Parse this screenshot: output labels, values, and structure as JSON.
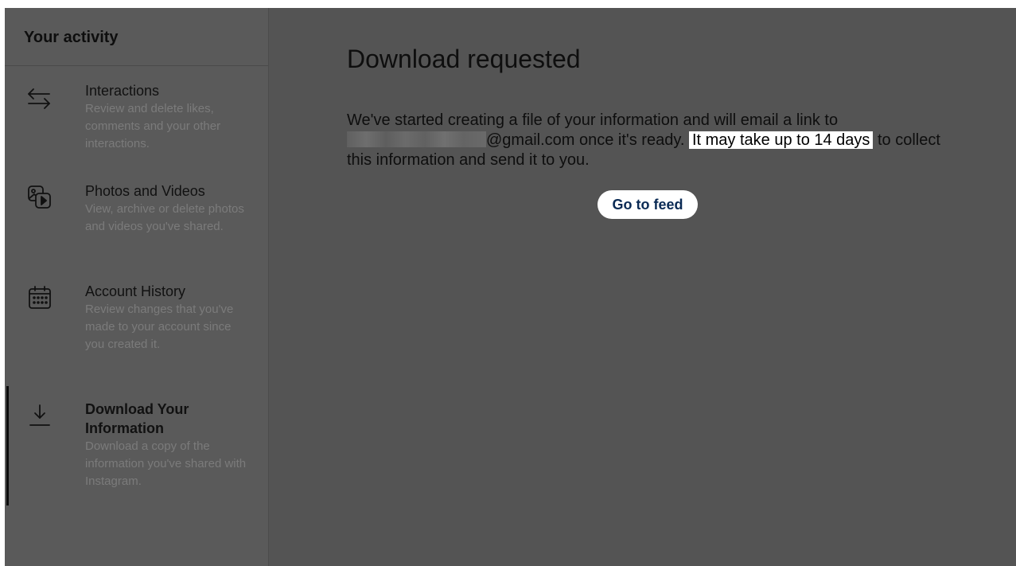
{
  "sidebar": {
    "title": "Your activity",
    "items": [
      {
        "icon": "interactions-arrows-icon",
        "title": "Interactions",
        "description": "Review and delete likes, comments and your other interactions."
      },
      {
        "icon": "photos-videos-icon",
        "title": "Photos and Videos",
        "description": "View, archive or delete photos and videos you've shared."
      },
      {
        "icon": "calendar-icon",
        "title": "Account History",
        "description": "Review changes that you've made to your account since you created it."
      },
      {
        "icon": "download-icon",
        "title": "Download Your Information",
        "description": "Download a copy of the information you've shared with Instagram.",
        "active": true
      }
    ]
  },
  "main": {
    "title": "Download requested",
    "body_part1": "We've started creating a file of your information and will email a link to",
    "email_domain": "@gmail.com",
    "body_part2": "once it's ready.",
    "highlight": "It may take up to 14 days",
    "body_part3": "to collect this information and send it to you.",
    "button_label": "Go to feed"
  },
  "colors": {
    "background": "#545454",
    "sidebar_background": "#5a5a5a",
    "button_text": "#0a2a54",
    "highlight_background": "#ffffff"
  }
}
